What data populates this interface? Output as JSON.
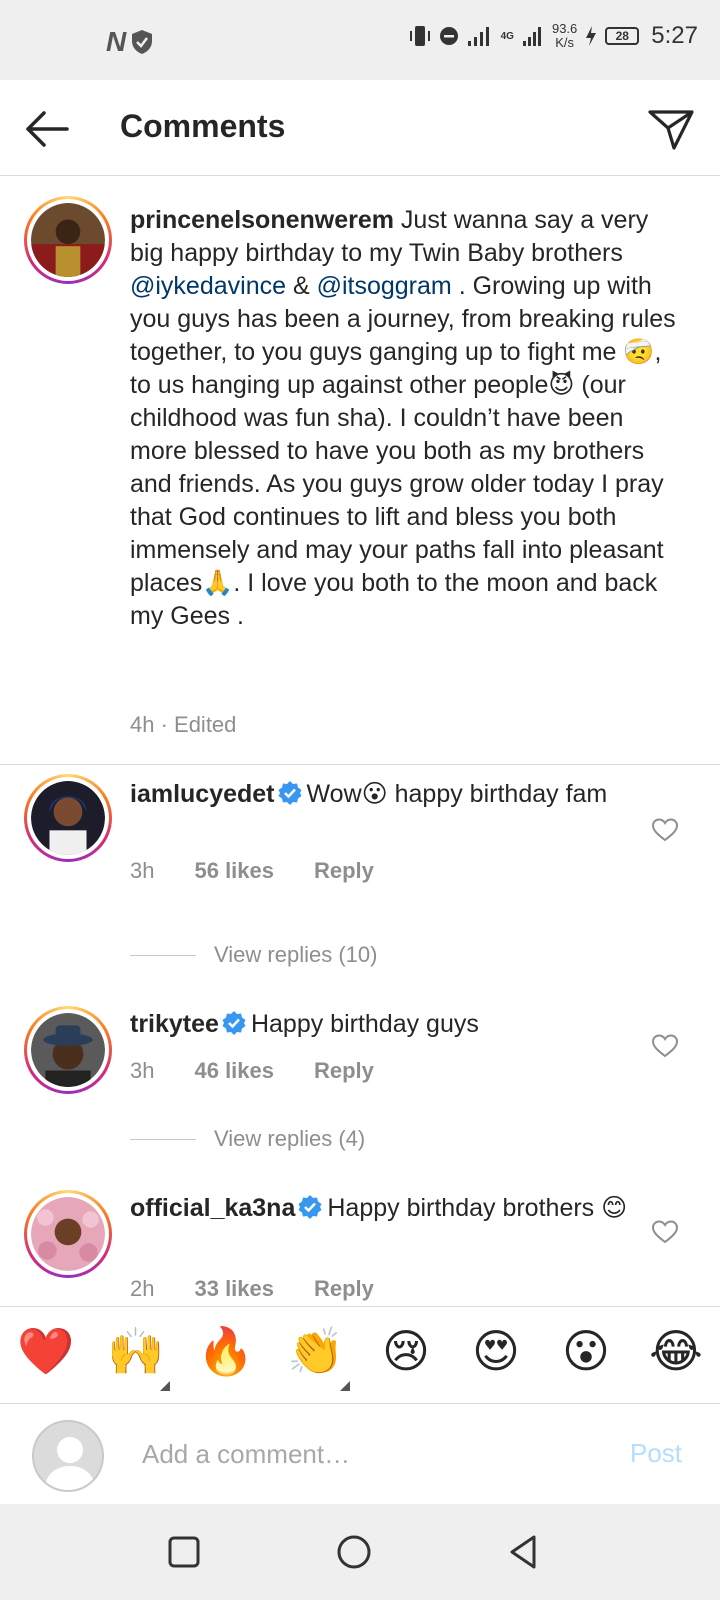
{
  "status_bar": {
    "left_glyph": "N",
    "speed_value": "93.6",
    "speed_unit": "K/s",
    "network": "4G",
    "battery": "28",
    "time": "5:27"
  },
  "header": {
    "title": "Comments"
  },
  "caption": {
    "username": "princenelsonenwerem",
    "text_1": " Just wanna say a very big happy birthday to my Twin Baby brothers ",
    "mention_1": "@iykedavince",
    "text_2": " & ",
    "mention_2": "@itsoggram",
    "text_3": " . Growing up with you guys has been a journey, from breaking rules together, to you guys ganging up to fight me 🤕, to us hanging up against other people😈 (our childhood was fun sha). I couldn’t have been more blessed to have you both as my brothers and friends. As you guys grow older today I pray that God continues to lift and bless you both immensely and may your paths fall into pleasant places🙏. I love you both to the moon and back my Gees .",
    "meta": "4h · Edited"
  },
  "comments": [
    {
      "username": "iamlucyedet",
      "text": "Wow😮 happy birthday fam",
      "time": "3h",
      "likes": "56 likes",
      "reply": "Reply",
      "view_replies": "View replies (10)"
    },
    {
      "username": "trikytee",
      "text": "Happy birthday guys",
      "time": "3h",
      "likes": "46 likes",
      "reply": "Reply",
      "view_replies": "View replies (4)"
    },
    {
      "username": "official_ka3na",
      "text": "Happy birthday brothers 😊",
      "time": "2h",
      "likes": "33 likes",
      "reply": "Reply"
    }
  ],
  "emoji_bar": [
    "❤️",
    "🙌",
    "🔥",
    "👏",
    "😢",
    "😍",
    "😮",
    "😂"
  ],
  "comment_box": {
    "placeholder": "Add a comment…",
    "post_label": "Post"
  },
  "colors": {
    "mention": "#00376b",
    "verified": "#3897f0",
    "post_disabled": "#b2dffc",
    "meta_gray": "#8e8e8e"
  }
}
